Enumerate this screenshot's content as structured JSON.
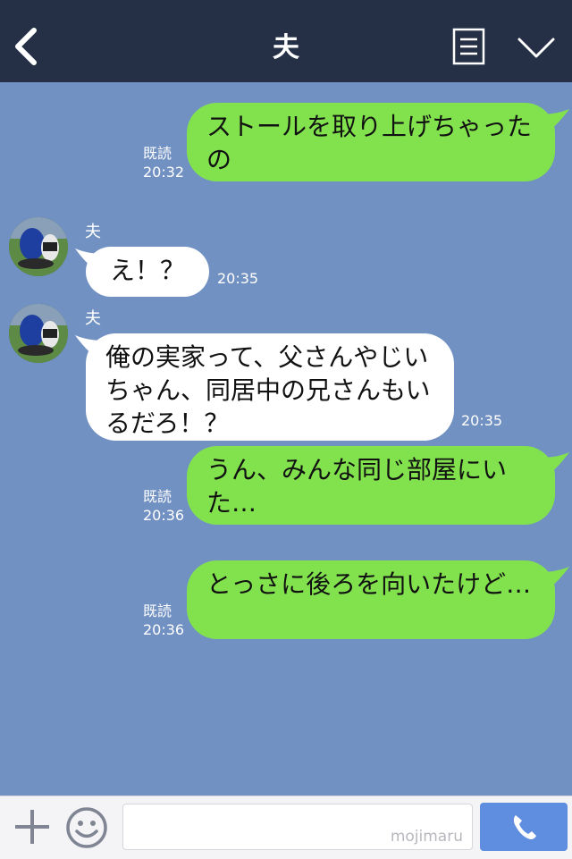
{
  "header": {
    "title": "夫"
  },
  "messages": {
    "m1": {
      "text": "ストールを取り上げちゃったの",
      "read": "既読",
      "time": "20:32"
    },
    "m2": {
      "sender": "夫",
      "text": "え！？",
      "time": "20:35"
    },
    "m3": {
      "sender": "夫",
      "text": "俺の実家って、父さんやじいちゃん、同居中の兄さんもいるだろ！？",
      "time": "20:35"
    },
    "m4": {
      "text": "うん、みんな同じ部屋にいた…",
      "read": "既読",
      "time": "20:36"
    },
    "m5": {
      "text": "とっさに後ろを向いたけど…",
      "read": "既読",
      "time": "20:36"
    }
  },
  "input": {
    "watermark": "mojimaru"
  },
  "icons": {
    "back": "chevron-left-icon",
    "menu": "list-menu-icon",
    "collapse": "chevron-down-icon",
    "add": "plus-icon",
    "emoji": "smiley-icon",
    "call": "phone-icon"
  },
  "colors": {
    "header_bg": "#253047",
    "chat_bg": "#7291c3",
    "outgoing_bubble": "#82e24e",
    "incoming_bubble": "#ffffff",
    "call_button": "#5f8de0"
  }
}
